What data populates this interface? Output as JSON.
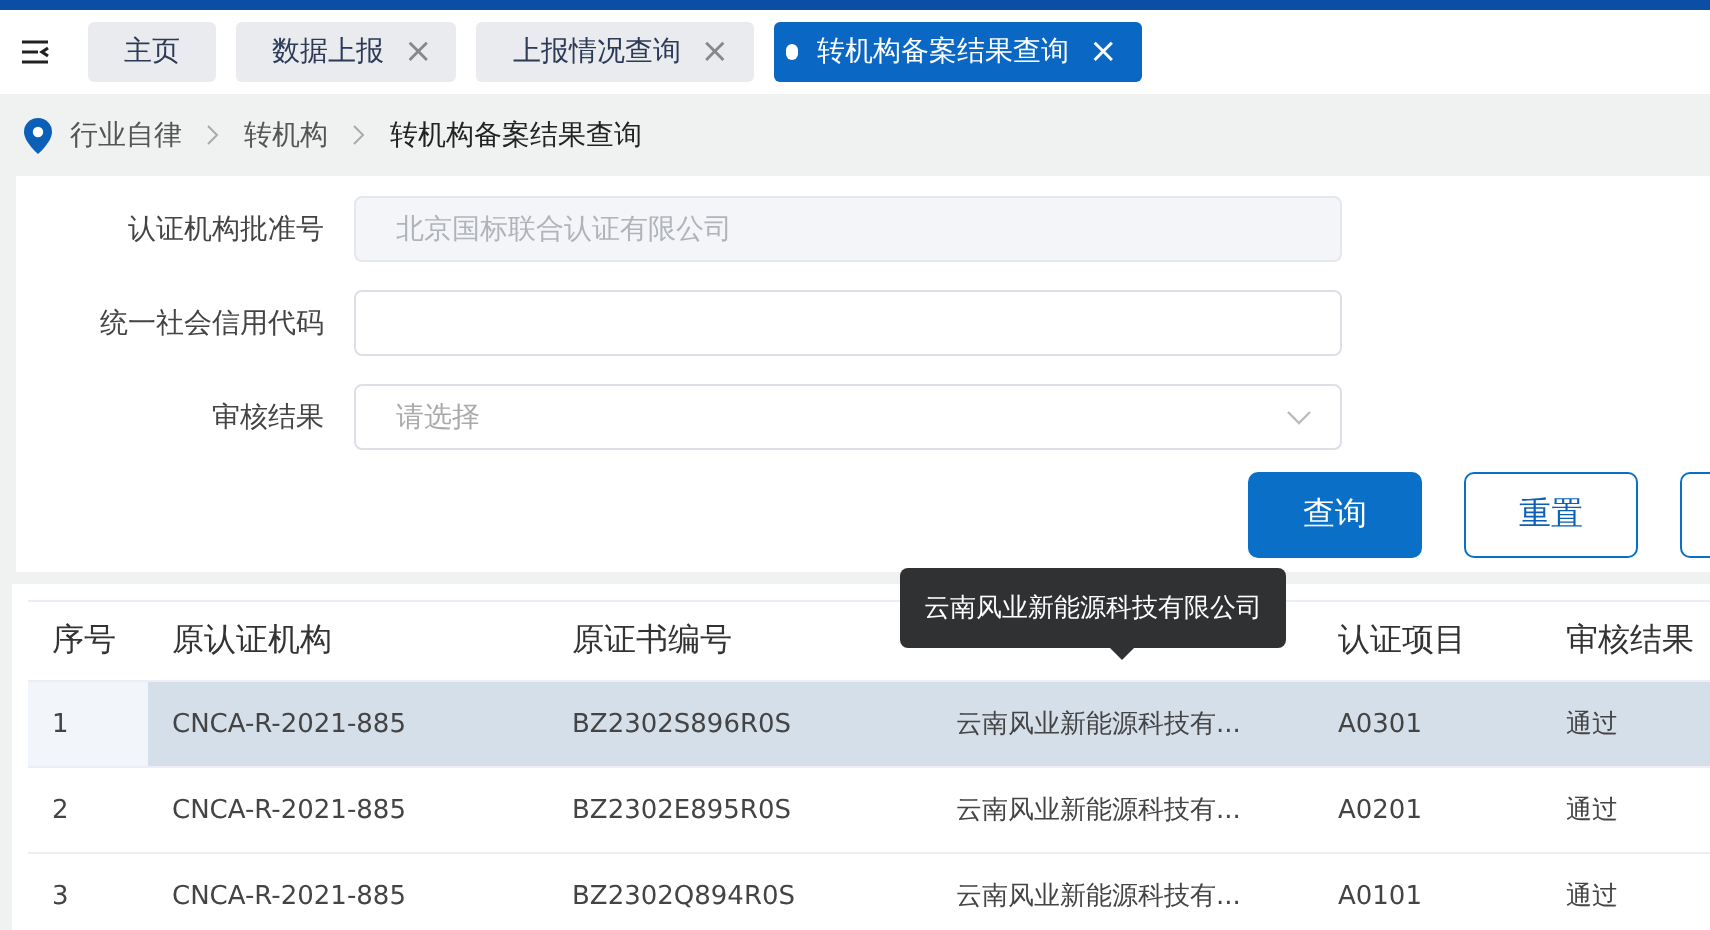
{
  "tabs": [
    {
      "label": "主页",
      "selected": false
    },
    {
      "label": "数据上报",
      "close": "×",
      "selected": false
    },
    {
      "label": "上报情况查询",
      "close": "×",
      "selected": false
    },
    {
      "label": "转机构备案结果查询",
      "close": "×",
      "selected": true
    }
  ],
  "breadcrumb": [
    "行业自律",
    "转机构",
    "转机构备案结果查询"
  ],
  "form": {
    "fields": [
      {
        "label": "认证机构批准号",
        "kind": "text",
        "value": "北京国标联合认证有限公司",
        "disabled": true
      },
      {
        "label": "统一社会信用代码",
        "kind": "text"
      },
      {
        "label": "审核结果",
        "kind": "select",
        "placeholder": "请选择"
      }
    ],
    "buttons": [
      {
        "label": "查询",
        "kind": "primary"
      },
      {
        "label": "重置",
        "kind": "plain"
      },
      {
        "kind": "plain"
      }
    ]
  },
  "table": {
    "columns": [
      "序号",
      "原认证机构",
      "原证书编号",
      "",
      "认证项目",
      "审核结果"
    ],
    "rows": [
      {
        "selected": true,
        "cells": [
          "1",
          "CNCA-R-2021-885",
          "BZ2302S896R0S",
          "云南风业新能源科技有...",
          "A0301",
          "通过"
        ]
      },
      {
        "selected": false,
        "cells": [
          "2",
          "CNCA-R-2021-885",
          "BZ2302E895R0S",
          "云南风业新能源科技有...",
          "A0201",
          "通过"
        ]
      },
      {
        "selected": false,
        "cells": [
          "3",
          "CNCA-R-2021-885",
          "BZ2302Q894R0S",
          "云南风业新能源科技有...",
          "A0101",
          "通过"
        ]
      }
    ]
  },
  "tooltip": "云南风业新能源科技有限公司"
}
